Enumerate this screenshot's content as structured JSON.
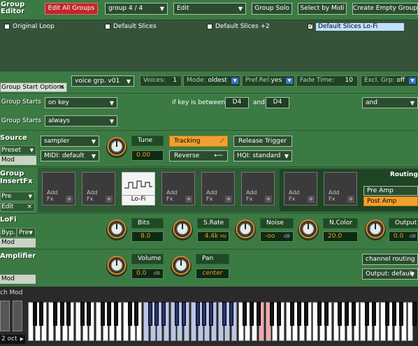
{
  "header": {
    "title": "Group\nEditor",
    "edit_all_groups": "Edit All Groups",
    "group_select": "group 4 / 4",
    "edit_menu": "Edit",
    "group_solo": "Group Solo",
    "select_by_midi": "Select by Midi",
    "create_empty_group": "Create Empty Group"
  },
  "groups": [
    {
      "name": "Original Loop",
      "checked": false
    },
    {
      "name": "Default Slices",
      "checked": false
    },
    {
      "name": "Default Slices +2",
      "checked": false
    },
    {
      "name": "Default Slices Lo-Fi",
      "checked": true
    }
  ],
  "voice_bar": {
    "voice_group": "voice grp. v01",
    "voices_label": "Voices:",
    "voices_value": "1",
    "mode_label": "Mode:",
    "mode_value": "oldest",
    "pref_rel": "Pref.Rel:",
    "pref_rel_value": "yes",
    "fade_time_label": "Fade Time:",
    "fade_time_value": "10",
    "excl_grp_label": "Excl. Grp:",
    "excl_grp_value": "off"
  },
  "group_start": {
    "tab": "Group Start Options",
    "row1_label": "Group Starts",
    "row1_value": "on key",
    "key_between": "if key is between",
    "key_from": "D4",
    "and_label": "and",
    "key_to": "D4",
    "logic": "and",
    "row2_label": "Group Starts",
    "row2_value": "always"
  },
  "source": {
    "title": "Source",
    "preset": "Preset",
    "mod": "Mod",
    "mode": "sampler",
    "midi": "MIDI: default",
    "tune_label": "Tune",
    "tune_value": "0.00",
    "tracking": "Tracking",
    "reverse": "Reverse",
    "release_trigger": "Release Trigger",
    "hq": "HQI: standard"
  },
  "insert_fx": {
    "title": "Group\nInsertFx",
    "pre": "Pre",
    "edit": "Edit",
    "slots": [
      "Add\nFx",
      "Add\nFx",
      "Lo-Fi",
      "Add\nFx",
      "Add\nFx",
      "Add\nFx",
      "Add\nFx",
      "Add\nFx"
    ],
    "routing_title": "Routing",
    "pre_amp": "Pre Amp",
    "post_amp": "Post Amp"
  },
  "lofi": {
    "title": "LoFi",
    "byp": "Byp.",
    "pre": "Pre",
    "mod": "Mod",
    "bits_label": "Bits",
    "bits_value": "8.0",
    "srate_label": "S.Rate",
    "srate_value": "4.4k",
    "srate_unit": "Hz",
    "noise_label": "Noise",
    "noise_value": "-oo",
    "noise_unit": "dB",
    "ncolor_label": "N.Color",
    "ncolor_value": "20.0",
    "output_label": "Output",
    "output_value": "0.0",
    "output_unit": "dB"
  },
  "amplifier": {
    "title": "Amplifier",
    "mod": "Mod",
    "volume_label": "Volume",
    "volume_value": "0.0",
    "volume_unit": "dB",
    "pan_label": "Pan",
    "pan_value": "center",
    "channel_routing": "channel routing",
    "output": "Output: default"
  },
  "keyboard": {
    "label": "ch Mod",
    "octave": "2 oct"
  },
  "colors": {
    "bg": "#3c7a44",
    "accent_orange": "#f0a030",
    "red_button": "#c1282a",
    "selected_group": "#bfe0ff"
  }
}
